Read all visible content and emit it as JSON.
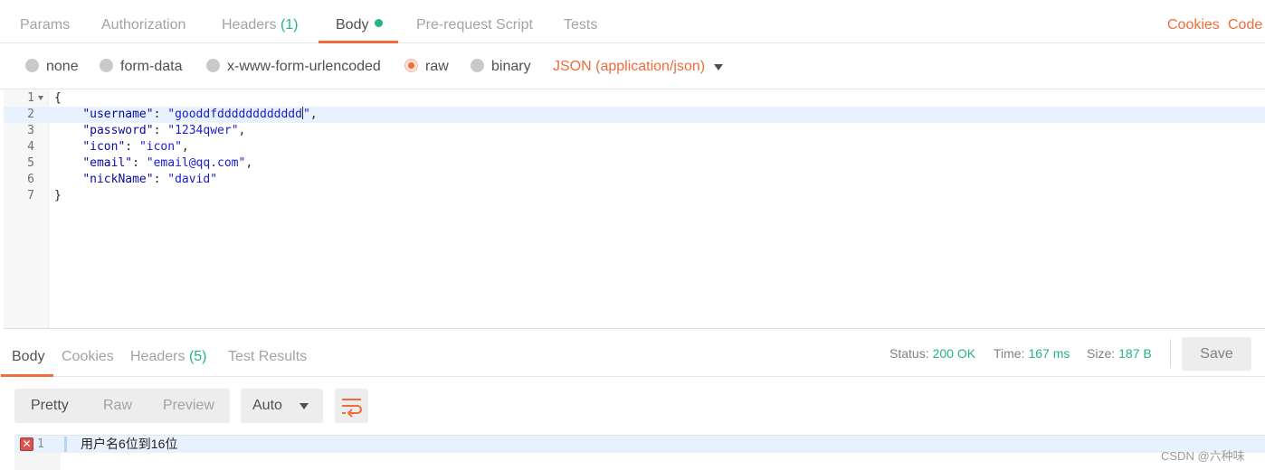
{
  "request_tabs": {
    "params": "Params",
    "authorization": "Authorization",
    "headers": "Headers",
    "headers_count": "(1)",
    "body": "Body",
    "prerequest": "Pre-request Script",
    "tests": "Tests",
    "cookies": "Cookies",
    "code": "Code"
  },
  "body_options": {
    "none": "none",
    "form_data": "form-data",
    "urlencoded": "x-www-form-urlencoded",
    "raw": "raw",
    "binary": "binary",
    "selected": "raw",
    "content_type": "JSON (application/json)"
  },
  "editor": {
    "active_line": 2,
    "line_numbers": [
      "1",
      "2",
      "3",
      "4",
      "5",
      "6",
      "7"
    ],
    "open_brace": "{",
    "close_brace": "}",
    "fields": [
      {
        "key": "\"username\"",
        "value": "\"gooddfdddddddddddd",
        "value_tail": "\"",
        "suffix": ","
      },
      {
        "key": "\"password\"",
        "value": "\"1234qwer\"",
        "suffix": ","
      },
      {
        "key": "\"icon\"",
        "value": "\"icon\"",
        "suffix": ","
      },
      {
        "key": "\"email\"",
        "value": "\"email@qq.com\"",
        "suffix": ","
      },
      {
        "key": "\"nickName\"",
        "value": "\"david\"",
        "suffix": ""
      }
    ]
  },
  "response_tabs": {
    "body": "Body",
    "cookies": "Cookies",
    "headers": "Headers",
    "headers_count": "(5)",
    "test_results": "Test Results"
  },
  "response_meta": {
    "status_label": "Status:",
    "status_value": "200 OK",
    "time_label": "Time:",
    "time_value": "167 ms",
    "size_label": "Size:",
    "size_value": "187 B",
    "save": "Save"
  },
  "response_toolbar": {
    "pretty": "Pretty",
    "raw": "Raw",
    "preview": "Preview",
    "format": "Auto",
    "wrap_icon": "wrap-lines-icon"
  },
  "response_body": {
    "line_number": "1",
    "error_icon": "error-icon",
    "text": "用户名6位到16位"
  },
  "watermark": "CSDN @六种味",
  "colors": {
    "accent": "#f26b3a",
    "success": "#26b47f",
    "muted": "#a3a3a3",
    "text": "#505050"
  }
}
